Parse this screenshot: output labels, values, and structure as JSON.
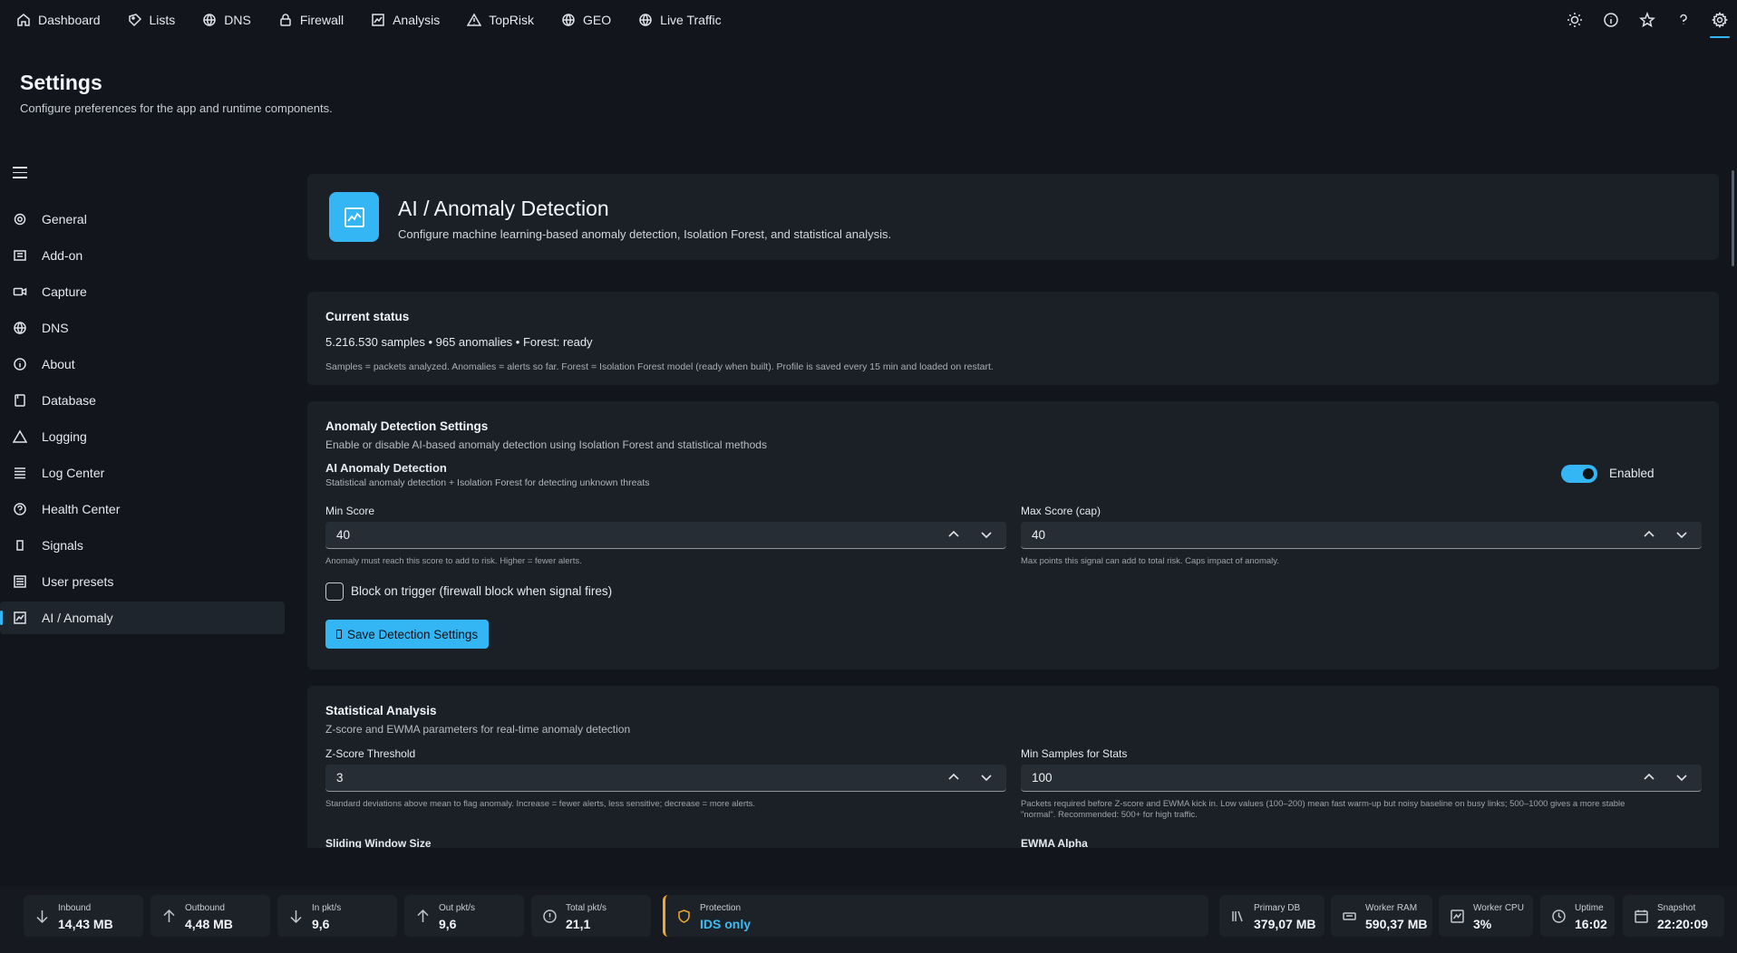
{
  "nav": {
    "items": [
      {
        "label": "Dashboard",
        "icon": "home-icon"
      },
      {
        "label": "Lists",
        "icon": "tag-icon"
      },
      {
        "label": "DNS",
        "icon": "globe-icon"
      },
      {
        "label": "Firewall",
        "icon": "lock-icon"
      },
      {
        "label": "Analysis",
        "icon": "chart-icon"
      },
      {
        "label": "TopRisk",
        "icon": "warning-icon"
      },
      {
        "label": "GEO",
        "icon": "globe-icon"
      },
      {
        "label": "Live Traffic",
        "icon": "globe-icon"
      }
    ],
    "right_icons": [
      "sun-icon",
      "info-icon",
      "star-icon",
      "help-icon",
      "gear-icon"
    ],
    "active_icon": "gear-icon"
  },
  "page": {
    "title": "Settings",
    "subtitle": "Configure preferences for the app and runtime components."
  },
  "sidebar": {
    "items": [
      {
        "label": "General",
        "icon": "gear-icon"
      },
      {
        "label": "Add-on",
        "icon": "addon-icon"
      },
      {
        "label": "Capture",
        "icon": "camera-icon"
      },
      {
        "label": "DNS",
        "icon": "globe-icon"
      },
      {
        "label": "About",
        "icon": "info-icon"
      },
      {
        "label": "Database",
        "icon": "database-icon"
      },
      {
        "label": "Logging",
        "icon": "warning-icon"
      },
      {
        "label": "Log Center",
        "icon": "list-icon"
      },
      {
        "label": "Health Center",
        "icon": "help-icon"
      },
      {
        "label": "Signals",
        "icon": "signal-icon"
      },
      {
        "label": "User presets",
        "icon": "preset-icon"
      },
      {
        "label": "AI / Anomaly",
        "icon": "chart-icon"
      }
    ],
    "active": "AI / Anomaly"
  },
  "hero": {
    "title": "AI / Anomaly Detection",
    "description": "Configure machine learning-based anomaly detection, Isolation Forest, and statistical analysis."
  },
  "status": {
    "title": "Current status",
    "line": "5.216.530 samples • 965 anomalies • Forest: ready",
    "note": "Samples = packets analyzed. Anomalies = alerts so far. Forest = Isolation Forest model (ready when built). Profile is saved every 15 min and loaded on restart."
  },
  "detection": {
    "title": "Anomaly Detection Settings",
    "description": "Enable or disable AI-based anomaly detection using Isolation Forest and statistical methods",
    "toggle_title": "AI Anomaly Detection",
    "toggle_desc": "Statistical anomaly detection + Isolation Forest for detecting unknown threats",
    "toggle_state": "Enabled",
    "min_score_label": "Min Score",
    "min_score_value": "40",
    "min_score_help": "Anomaly must reach this score to add to risk. Higher = fewer alerts.",
    "max_score_label": "Max Score (cap)",
    "max_score_value": "40",
    "max_score_help": "Max points this signal can add to total risk. Caps impact of anomaly.",
    "block_label": "Block on trigger (firewall block when signal fires)",
    "save_label": "Save Detection Settings"
  },
  "statistical": {
    "title": "Statistical Analysis",
    "description": "Z-score and EWMA parameters for real-time anomaly detection",
    "zscore_label": "Z-Score Threshold",
    "zscore_value": "3",
    "zscore_help": "Standard deviations above mean to flag anomaly. Increase = fewer alerts, less sensitive; decrease = more alerts.",
    "minsamples_label": "Min Samples for Stats",
    "minsamples_value": "100",
    "minsamples_help_1": "Packets required before Z-score and EWMA kick in. Low values (100–200) mean fast warm-up but noisy baseline on busy links; 500–1000 gives a more stable",
    "minsamples_help_2": "\"normal\". Recommended: 500+ for high traffic.",
    "window_label": "Sliding Window Size",
    "ewma_label": "EWMA Alpha"
  },
  "statusbar": {
    "inbound_label": "Inbound",
    "inbound_value": "14,43 MB",
    "outbound_label": "Outbound",
    "outbound_value": "4,48 MB",
    "inpkt_label": "In pkt/s",
    "inpkt_value": "9,6",
    "outpkt_label": "Out pkt/s",
    "outpkt_value": "9,6",
    "totalpkt_label": "Total pkt/s",
    "totalpkt_value": "21,1",
    "protection_label": "Protection",
    "protection_value": "IDS only",
    "primarydb_label": "Primary DB",
    "primarydb_value": "379,07 MB",
    "workerram_label": "Worker RAM",
    "workerram_value": "590,37 MB",
    "workercpu_label": "Worker CPU",
    "workercpu_value": "3%",
    "uptime_label": "Uptime",
    "uptime_value": "16:02",
    "snapshot_label": "Snapshot",
    "snapshot_value": "22:20:09"
  },
  "colors": {
    "accent": "#35b6f4",
    "background": "#12161c",
    "card": "#1b2027",
    "protection_border": "#f0a830"
  }
}
